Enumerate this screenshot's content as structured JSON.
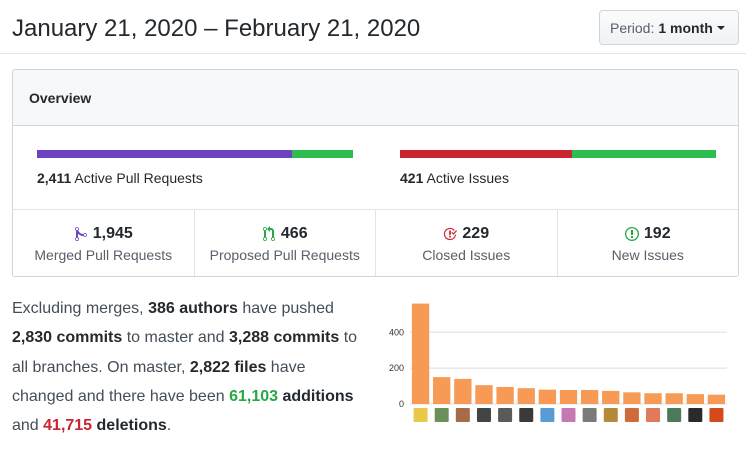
{
  "header": {
    "date_range": "January 21, 2020 – February 21, 2020",
    "period_label": "Period:",
    "period_value": "1 month"
  },
  "overview": {
    "title": "Overview",
    "pull_requests_bar": {
      "merged_fraction": 0.806,
      "merged_color": "#6f42c1",
      "open_color": "#2cbe4e"
    },
    "issues_bar": {
      "closed_fraction": 0.544,
      "closed_color": "#cb2431",
      "open_color": "#2cbe4e"
    },
    "active_pr_count": "2,411",
    "active_pr_label": "Active Pull Requests",
    "active_issues_count": "421",
    "active_issues_label": "Active Issues",
    "stats": [
      {
        "value": "1,945",
        "label": "Merged Pull Requests",
        "icon": "git-merge-icon",
        "color": "#6f42c1"
      },
      {
        "value": "466",
        "label": "Proposed Pull Requests",
        "icon": "git-pull-request-icon",
        "color": "#28a745"
      },
      {
        "value": "229",
        "label": "Closed Issues",
        "icon": "issue-closed-icon",
        "color": "#cb2431"
      },
      {
        "value": "192",
        "label": "New Issues",
        "icon": "issue-opened-icon",
        "color": "#28a745"
      }
    ]
  },
  "summary": {
    "t1": "Excluding merges, ",
    "authors": "386 authors",
    "t2": " have pushed ",
    "commits_master": "2,830 commits",
    "t3": " to master and ",
    "commits_all": "3,288 commits",
    "t4": " to all branches. On master, ",
    "files": "2,822 files",
    "t5": " have changed and there have been ",
    "additions_num": "61,103",
    "additions_word": " additions",
    "t6": " and ",
    "deletions_num": "41,715",
    "deletions_word": " deletions",
    "t7": "."
  },
  "chart_data": {
    "type": "bar",
    "categories": [
      "author-1",
      "author-2",
      "author-3",
      "author-4",
      "author-5",
      "author-6",
      "author-7",
      "author-8",
      "author-9",
      "author-10",
      "author-11",
      "author-12",
      "author-13",
      "author-14",
      "author-15"
    ],
    "values": [
      560,
      150,
      140,
      105,
      95,
      88,
      80,
      78,
      78,
      73,
      65,
      60,
      60,
      55,
      52
    ],
    "ylim": [
      0,
      580
    ],
    "yticks": [
      "0",
      "200",
      "400"
    ],
    "ytick_values": [
      0,
      200,
      400
    ],
    "bar_color": "#f79a55",
    "grid": true,
    "avatar_colors": [
      "#e8c94a",
      "#6b8f5a",
      "#a86b4a",
      "#444444",
      "#5a5a5a",
      "#3a3a3a",
      "#5a9bd5",
      "#c47ab0",
      "#7a7a7a",
      "#b5893a",
      "#d06a3a",
      "#e07a5a",
      "#4a7a5a",
      "#2a2a2a",
      "#d44a1a"
    ]
  }
}
